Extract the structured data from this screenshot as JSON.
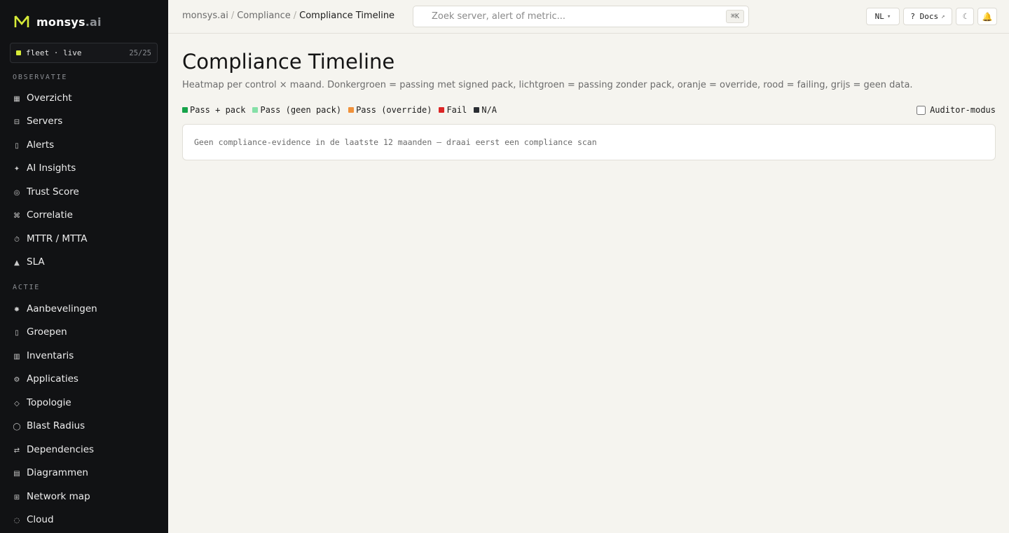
{
  "brand": {
    "name": "monsys",
    "suffix": ".ai",
    "accent": "#d7ec38"
  },
  "fleet": {
    "label": "fleet · live",
    "count": "25/25"
  },
  "sidebar": {
    "sections": [
      {
        "label": "OBSERVATIE",
        "items": [
          {
            "label": "Overzicht",
            "icon": "grid-icon"
          },
          {
            "label": "Servers",
            "icon": "server-icon"
          },
          {
            "label": "Alerts",
            "icon": "bell-icon"
          },
          {
            "label": "AI Insights",
            "icon": "sparkle-icon"
          },
          {
            "label": "Trust Score",
            "icon": "target-icon"
          },
          {
            "label": "Correlatie",
            "icon": "command-icon"
          },
          {
            "label": "MTTR / MTTA",
            "icon": "stopwatch-icon"
          },
          {
            "label": "SLA",
            "icon": "triangle-icon"
          }
        ]
      },
      {
        "label": "ACTIE",
        "items": [
          {
            "label": "Aanbevelingen",
            "icon": "star-icon"
          },
          {
            "label": "Groepen",
            "icon": "folder-icon"
          },
          {
            "label": "Inventaris",
            "icon": "list-icon"
          },
          {
            "label": "Applicaties",
            "icon": "gear-icon"
          },
          {
            "label": "Topologie",
            "icon": "diamond-icon"
          },
          {
            "label": "Blast Radius",
            "icon": "circle-icon"
          },
          {
            "label": "Dependencies",
            "icon": "swap-icon"
          },
          {
            "label": "Diagrammen",
            "icon": "chart-icon"
          },
          {
            "label": "Network map",
            "icon": "network-icon"
          },
          {
            "label": "Cloud",
            "icon": "cloud-icon"
          }
        ]
      }
    ]
  },
  "header": {
    "breadcrumbs": [
      "monsys.ai",
      "Compliance",
      "Compliance Timeline"
    ],
    "search": {
      "placeholder": "Zoek server, alert of metric...",
      "value": "",
      "shortcut": "⌘K"
    },
    "language": "NL",
    "docs_label": "? Docs",
    "theme_icon": "☾",
    "notify_icon": "🔔"
  },
  "page": {
    "title": "Compliance Timeline",
    "description": "Heatmap per control × maand. Donkergroen = passing met signed pack, lichtgroen = passing zonder pack, oranje = override, rood = failing, grijs = geen data.",
    "legend": [
      {
        "label": "Pass + pack",
        "color": "#16a34a"
      },
      {
        "label": "Pass (geen pack)",
        "color": "#86e0a8"
      },
      {
        "label": "Pass (override)",
        "color": "#f0913a"
      },
      {
        "label": "Fail",
        "color": "#dc2626"
      },
      {
        "label": "N/A",
        "color": "#2a2d33"
      }
    ],
    "auditor_mode": {
      "label": "Auditor-modus",
      "checked": false
    },
    "empty_message": "Geen compliance-evidence in de laatste 12 maanden — draai eerst een compliance scan"
  }
}
